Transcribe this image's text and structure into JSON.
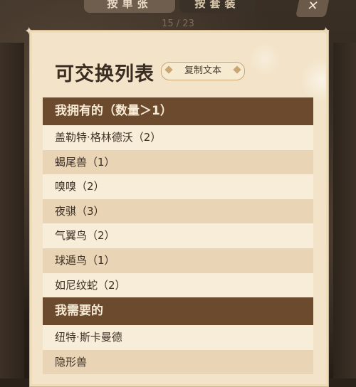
{
  "top_tabs": [
    "按单张",
    "按套装"
  ],
  "close_label": "✕",
  "page_counter": "15 / 23",
  "title": "可交换列表",
  "copy_button": "复制文本",
  "sections": [
    {
      "header": "我拥有的（数量＞1）",
      "items": [
        "盖勒特·格林德沃（2）",
        "蝎尾兽（1）",
        "嗅嗅（2）",
        "夜骐（3）",
        "气翼鸟（2）",
        "球遁鸟（1）",
        "如尼纹蛇（2）"
      ]
    },
    {
      "header": "我需要的",
      "items": [
        "纽特·斯卡曼德",
        "隐形兽"
      ]
    }
  ]
}
